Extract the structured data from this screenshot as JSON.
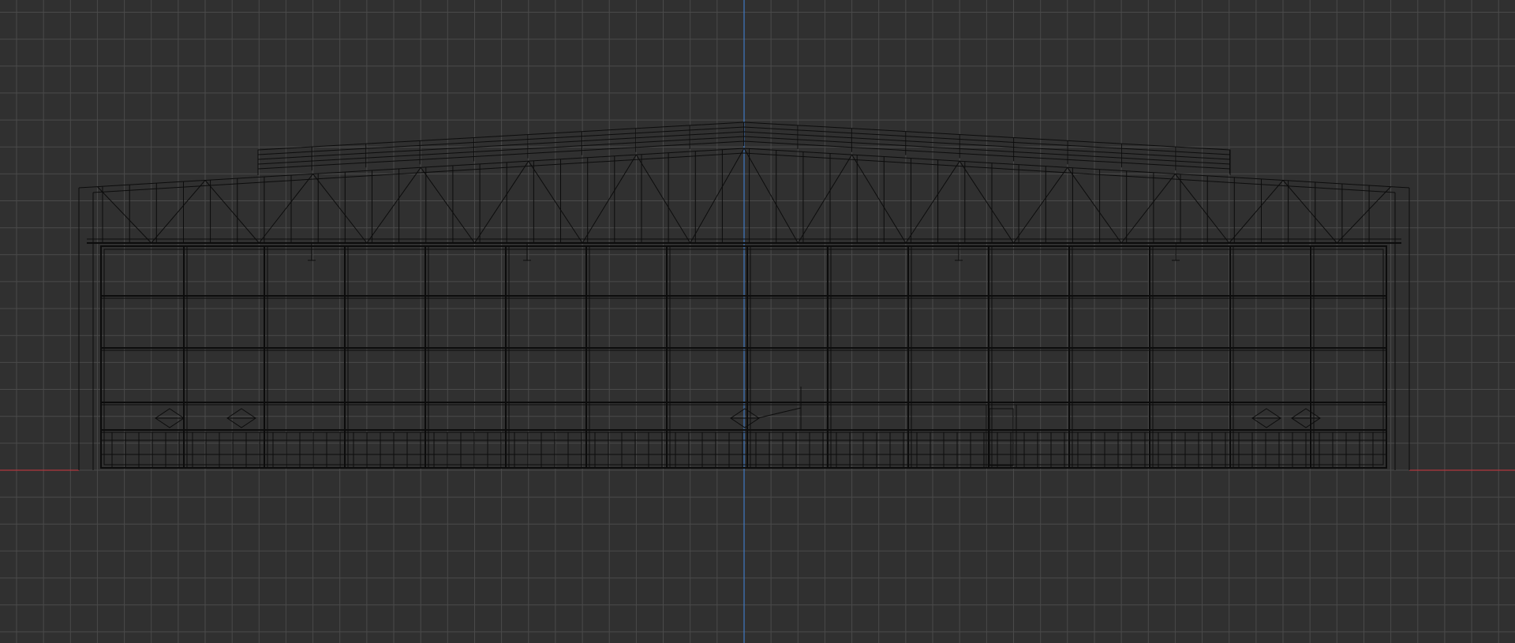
{
  "viewport": {
    "view": "front-orthographic",
    "shading": "wireframe",
    "grid": true,
    "model": "hangar",
    "colors": {
      "background": "#303030",
      "grid_minor": "#4a4a4a",
      "grid_major": "#3e3e3e",
      "x_axis": "#b0363d",
      "z_axis": "#3f74b8",
      "wire": "#0c0c0c"
    }
  }
}
